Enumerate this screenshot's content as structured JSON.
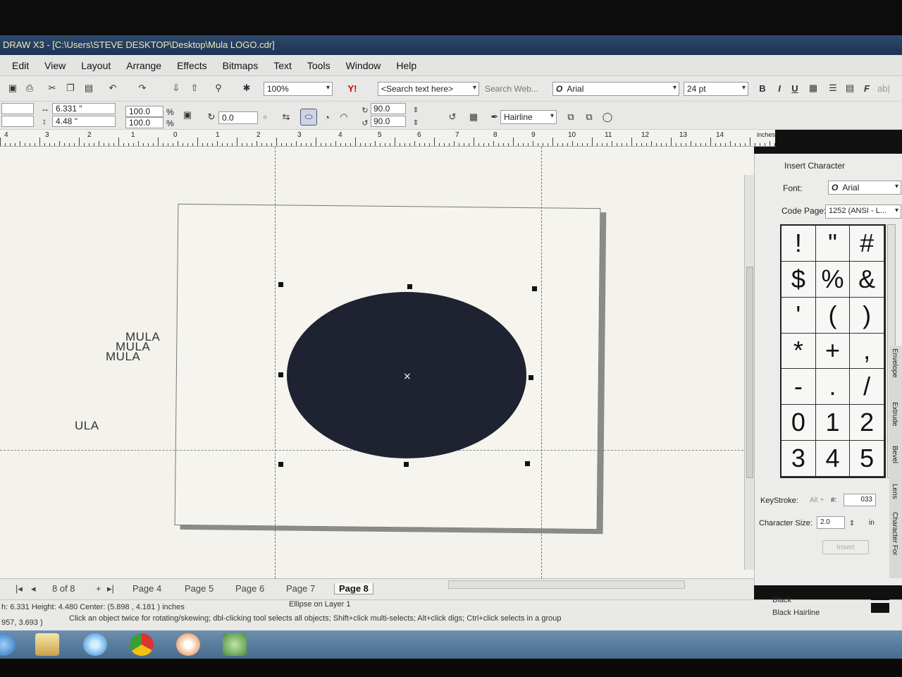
{
  "window": {
    "title": "DRAW X3 - [C:\\Users\\STEVE DESKTOP\\Desktop\\Mula LOGO.cdr]"
  },
  "menu": [
    "Edit",
    "View",
    "Layout",
    "Arrange",
    "Effects",
    "Bitmaps",
    "Text",
    "Tools",
    "Window",
    "Help"
  ],
  "toolbar1": {
    "zoom": "100%",
    "search_text": "<Search text here>",
    "search_web": "Search Web...",
    "font": "Arial",
    "font_size": "24 pt",
    "bold": "B",
    "italic": "I",
    "underline": "U"
  },
  "propbar": {
    "width": "6.331 \"",
    "height": "4.48 \"",
    "scale_x": "100.0",
    "scale_y": "100.0",
    "percent": "%",
    "rotation": "0.0",
    "start_angle": "90.0",
    "end_angle": "90.0",
    "outline": "Hairline"
  },
  "ruler": {
    "labels": [
      "4",
      "3",
      "2",
      "1",
      "0",
      "1",
      "2",
      "3",
      "4",
      "5",
      "6",
      "7",
      "8",
      "9",
      "10",
      "11",
      "12",
      "13",
      "14"
    ],
    "unit": "inches"
  },
  "canvas": {
    "text_objects": [
      "MULA",
      "MULA",
      "MULA",
      "ULA"
    ]
  },
  "docker": {
    "title": "Insert Character",
    "font_label": "Font:",
    "font_value": "Arial",
    "codepage_label": "Code Page:",
    "codepage_value": "1252 (ANSI - L...",
    "characters": [
      "!",
      "\"",
      "#",
      "$",
      "%",
      "&",
      "'",
      "(",
      ")",
      "*",
      "+",
      ",",
      "-",
      ".",
      "/",
      "0",
      "1",
      "2",
      "3",
      "4",
      "5"
    ],
    "keystroke_label": "KeyStroke:",
    "keystroke_alt": "Alt +",
    "keystroke_hash": "#:",
    "keystroke_value": "033",
    "charsize_label": "Character Size:",
    "charsize_value": "2.0",
    "charsize_unit": "in",
    "insert_label": "Insert"
  },
  "side_tabs": [
    "Envelope",
    "Extrude",
    "Bevel",
    "Lens",
    "Character For"
  ],
  "page_nav": {
    "count": "8 of 8",
    "tabs": [
      "Page 4",
      "Page 5",
      "Page 6",
      "Page 7",
      "Page 8"
    ],
    "active": "Page 8"
  },
  "status": {
    "dims": "h: 6.331  Height: 4.480  Center: (5.898 , 4.181 )  inches",
    "object": "Ellipse on Layer 1",
    "coords": "957, 3.693 )",
    "hint": "Click an object twice for rotating/skewing; dbl-clicking tool selects all objects; Shift+click multi-selects; Alt+click digs; Ctrl+click selects in a group",
    "fill": "Black",
    "outline": "Black  Hairline"
  },
  "colors": {
    "ellipse": "#1f2230",
    "titlebar": "#2e4a6e"
  }
}
